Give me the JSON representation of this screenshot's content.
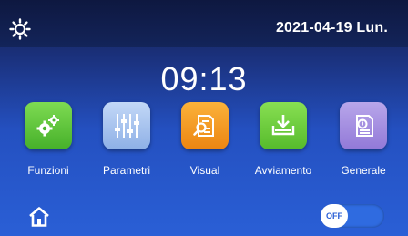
{
  "status_bar": {
    "date": "2021-04-19 Lun.",
    "brightness_icon": "sun-icon"
  },
  "clock": {
    "time": "09:13"
  },
  "apps": [
    {
      "label": "Funzioni",
      "icon": "gears-icon",
      "color": "#5cc73a"
    },
    {
      "label": "Parametri",
      "icon": "sliders-icon",
      "color": "#a9c6ef"
    },
    {
      "label": "Visual",
      "icon": "document-search-icon",
      "color": "#f39a1c"
    },
    {
      "label": "Avviamento",
      "icon": "download-icon",
      "color": "#6fcf3a"
    },
    {
      "label": "Generale",
      "icon": "info-document-icon",
      "color": "#a58fe0"
    }
  ],
  "bottom_bar": {
    "home_icon": "home-icon",
    "toggle_label": "OFF"
  }
}
